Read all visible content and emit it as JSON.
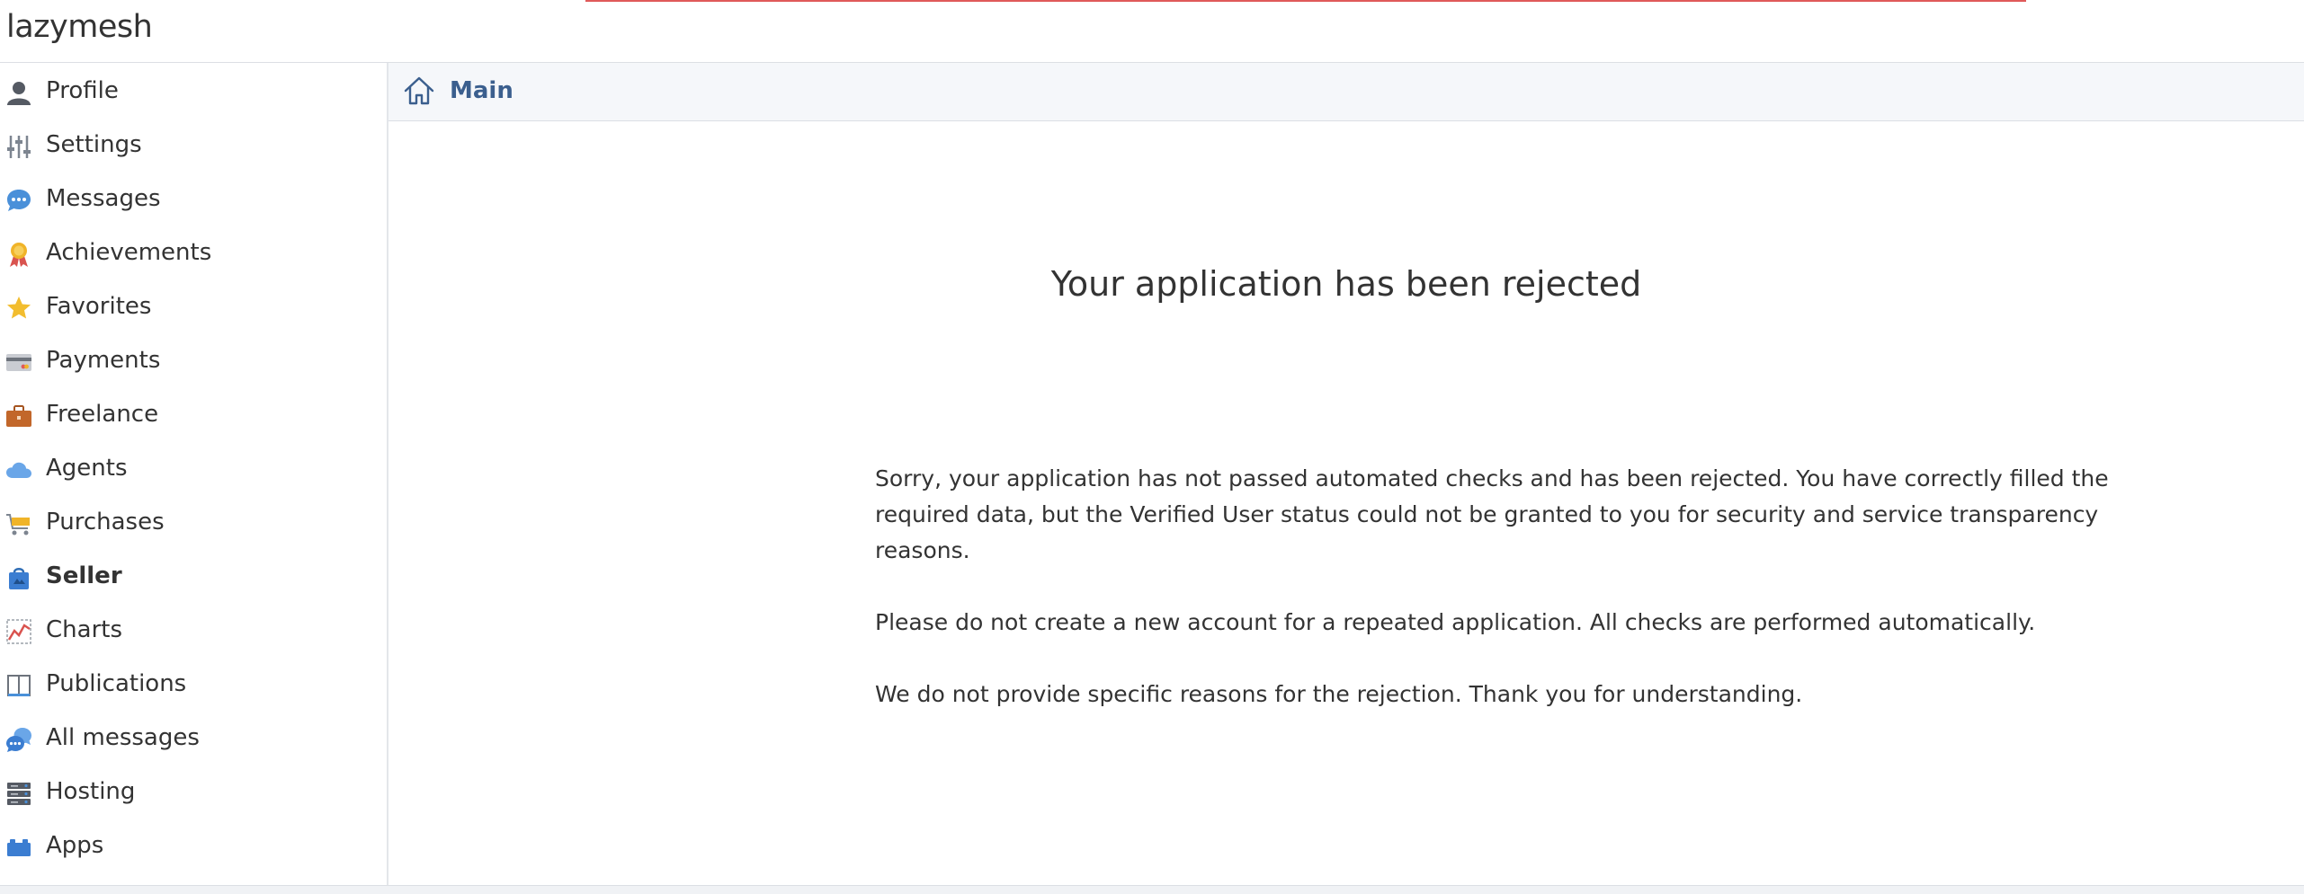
{
  "app": {
    "logo": "lazymesh"
  },
  "sidebar": {
    "items": [
      {
        "label": "Profile",
        "icon": "person-icon"
      },
      {
        "label": "Settings",
        "icon": "sliders-icon"
      },
      {
        "label": "Messages",
        "icon": "chat-bubble-icon"
      },
      {
        "label": "Achievements",
        "icon": "medal-icon"
      },
      {
        "label": "Favorites",
        "icon": "star-icon"
      },
      {
        "label": "Payments",
        "icon": "credit-card-icon"
      },
      {
        "label": "Freelance",
        "icon": "briefcase-icon"
      },
      {
        "label": "Agents",
        "icon": "cloud-icon"
      },
      {
        "label": "Purchases",
        "icon": "shopping-cart-icon"
      },
      {
        "label": "Seller",
        "icon": "shopping-bag-icon",
        "active": true
      },
      {
        "label": "Charts",
        "icon": "line-chart-icon"
      },
      {
        "label": "Publications",
        "icon": "book-icon"
      },
      {
        "label": "All messages",
        "icon": "chat-bubbles-icon"
      },
      {
        "label": "Hosting",
        "icon": "server-icon"
      },
      {
        "label": "Apps",
        "icon": "blocks-icon"
      }
    ]
  },
  "breadcrumb": {
    "label": "Main",
    "icon": "home-icon"
  },
  "main": {
    "icon": "clipboard-checklist-icon",
    "title": "Your application has been rejected",
    "paragraphs": [
      "Sorry, your application has not passed automated checks and has been rejected. You have correctly filled the required data, but the Verified User status could not be granted to you for security and service transparency reasons.",
      "Please do not create a new account for a repeated application. All checks are performed automatically.",
      "We do not provide specific reasons for the rejection. Thank you for understanding."
    ]
  },
  "colors": {
    "link": "#3b5f8e",
    "progress": "#e05a5a",
    "clipboard": "#7b68b5",
    "check_green": "#5fa84a",
    "cross_red": "#d9534f"
  }
}
